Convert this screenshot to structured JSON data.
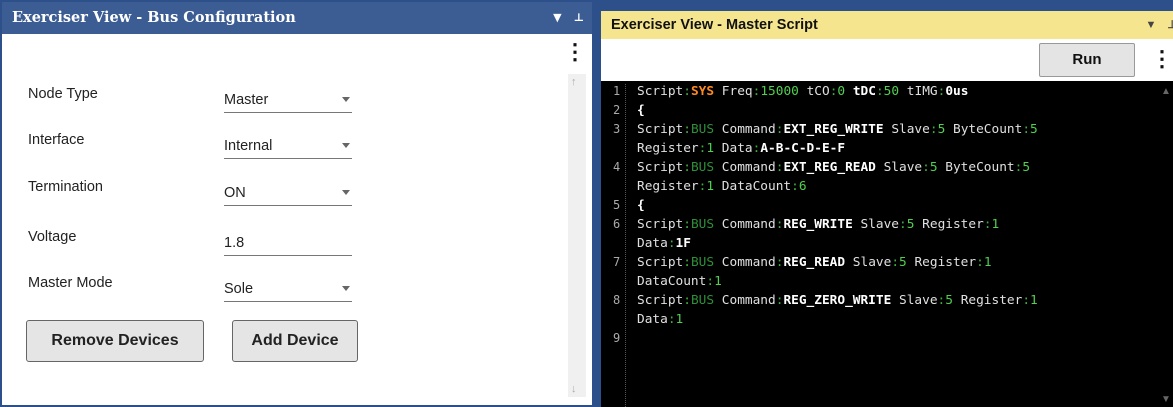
{
  "bus_panel": {
    "title": "Exerciser View - Bus Configuration",
    "icons": [
      "dropdown-caret-icon",
      "pin-icon"
    ],
    "menu_icon": "⋮",
    "fields": [
      {
        "label": "Node Type",
        "value": "Master",
        "dropdown": true
      },
      {
        "label": "Interface",
        "value": "Internal",
        "dropdown": true
      },
      {
        "label": "Termination",
        "value": "ON",
        "dropdown": true
      },
      {
        "label": "Voltage",
        "value": "1.8",
        "dropdown": false
      },
      {
        "label": "Master Mode",
        "value": "Sole",
        "dropdown": true
      }
    ],
    "remove_label": "Remove Devices",
    "add_label": "Add Device"
  },
  "script_panel": {
    "title": "Exerciser View - Master Script",
    "run_label": "Run",
    "menu_icon": "⋮",
    "line_numbers": [
      "1",
      "2",
      "3",
      "4",
      "5",
      "6",
      "7",
      "8",
      "9"
    ],
    "lines": [
      [
        {
          "t": "Script",
          "c": "k"
        },
        {
          "t": ":",
          "c": "sep"
        },
        {
          "t": "SYS",
          "c": "sys"
        },
        {
          "t": " Freq",
          "c": "k"
        },
        {
          "t": ":",
          "c": "sep"
        },
        {
          "t": "15000",
          "c": "num"
        },
        {
          "t": " tCO",
          "c": "k"
        },
        {
          "t": ":",
          "c": "sep"
        },
        {
          "t": "0",
          "c": "num"
        },
        {
          "t": " tDC",
          "c": "w"
        },
        {
          "t": ":",
          "c": "sep"
        },
        {
          "t": "50",
          "c": "num"
        },
        {
          "t": " tIMG",
          "c": "k"
        },
        {
          "t": ":",
          "c": "sep"
        },
        {
          "t": "0us",
          "c": "w"
        }
      ],
      [
        {
          "t": "{",
          "c": "w"
        }
      ],
      [
        {
          "t": "Script",
          "c": "k"
        },
        {
          "t": ":",
          "c": "sep"
        },
        {
          "t": "BUS",
          "c": "bus"
        },
        {
          "t": " Command",
          "c": "k"
        },
        {
          "t": ":",
          "c": "sep"
        },
        {
          "t": "EXT_REG_WRITE",
          "c": "w"
        },
        {
          "t": " Slave",
          "c": "k"
        },
        {
          "t": ":",
          "c": "sep"
        },
        {
          "t": "5",
          "c": "num"
        },
        {
          "t": " ByteCount",
          "c": "k"
        },
        {
          "t": ":",
          "c": "sep"
        },
        {
          "t": "5",
          "c": "num"
        }
      ],
      [
        {
          "t": "Register",
          "c": "k"
        },
        {
          "t": ":",
          "c": "sep"
        },
        {
          "t": "1",
          "c": "num"
        },
        {
          "t": " Data",
          "c": "k"
        },
        {
          "t": ":",
          "c": "sep"
        },
        {
          "t": "A-B-C-D-E-F",
          "c": "w"
        }
      ],
      [
        {
          "t": "Script",
          "c": "k"
        },
        {
          "t": ":",
          "c": "sep"
        },
        {
          "t": "BUS",
          "c": "bus"
        },
        {
          "t": " Command",
          "c": "k"
        },
        {
          "t": ":",
          "c": "sep"
        },
        {
          "t": "EXT_REG_READ",
          "c": "w"
        },
        {
          "t": " Slave",
          "c": "k"
        },
        {
          "t": ":",
          "c": "sep"
        },
        {
          "t": "5",
          "c": "num"
        },
        {
          "t": " ByteCount",
          "c": "k"
        },
        {
          "t": ":",
          "c": "sep"
        },
        {
          "t": "5",
          "c": "num"
        }
      ],
      [
        {
          "t": "Register",
          "c": "k"
        },
        {
          "t": ":",
          "c": "sep"
        },
        {
          "t": "1",
          "c": "num"
        },
        {
          "t": " DataCount",
          "c": "k"
        },
        {
          "t": ":",
          "c": "sep"
        },
        {
          "t": "6",
          "c": "num"
        }
      ],
      [
        {
          "t": "{",
          "c": "w"
        }
      ],
      [
        {
          "t": "Script",
          "c": "k"
        },
        {
          "t": ":",
          "c": "sep"
        },
        {
          "t": "BUS",
          "c": "bus"
        },
        {
          "t": " Command",
          "c": "k"
        },
        {
          "t": ":",
          "c": "sep"
        },
        {
          "t": "REG_WRITE",
          "c": "w"
        },
        {
          "t": " Slave",
          "c": "k"
        },
        {
          "t": ":",
          "c": "sep"
        },
        {
          "t": "5",
          "c": "num"
        },
        {
          "t": " Register",
          "c": "k"
        },
        {
          "t": ":",
          "c": "sep"
        },
        {
          "t": "1",
          "c": "num"
        }
      ],
      [
        {
          "t": "Data",
          "c": "k"
        },
        {
          "t": ":",
          "c": "sep"
        },
        {
          "t": "1F",
          "c": "w"
        }
      ],
      [
        {
          "t": "Script",
          "c": "k"
        },
        {
          "t": ":",
          "c": "sep"
        },
        {
          "t": "BUS",
          "c": "bus"
        },
        {
          "t": " Command",
          "c": "k"
        },
        {
          "t": ":",
          "c": "sep"
        },
        {
          "t": "REG_READ",
          "c": "w"
        },
        {
          "t": " Slave",
          "c": "k"
        },
        {
          "t": ":",
          "c": "sep"
        },
        {
          "t": "5",
          "c": "num"
        },
        {
          "t": " Register",
          "c": "k"
        },
        {
          "t": ":",
          "c": "sep"
        },
        {
          "t": "1",
          "c": "num"
        }
      ],
      [
        {
          "t": "DataCount",
          "c": "k"
        },
        {
          "t": ":",
          "c": "sep"
        },
        {
          "t": "1",
          "c": "num"
        }
      ],
      [
        {
          "t": "Script",
          "c": "k"
        },
        {
          "t": ":",
          "c": "sep"
        },
        {
          "t": "BUS",
          "c": "bus"
        },
        {
          "t": " Command",
          "c": "k"
        },
        {
          "t": ":",
          "c": "sep"
        },
        {
          "t": "REG_ZERO_WRITE",
          "c": "w"
        },
        {
          "t": " Slave",
          "c": "k"
        },
        {
          "t": ":",
          "c": "sep"
        },
        {
          "t": "5",
          "c": "num"
        },
        {
          "t": " Register",
          "c": "k"
        },
        {
          "t": ":",
          "c": "sep"
        },
        {
          "t": "1",
          "c": "num"
        }
      ],
      [
        {
          "t": "Data",
          "c": "k"
        },
        {
          "t": ":",
          "c": "sep"
        },
        {
          "t": "1",
          "c": "num"
        }
      ]
    ]
  }
}
